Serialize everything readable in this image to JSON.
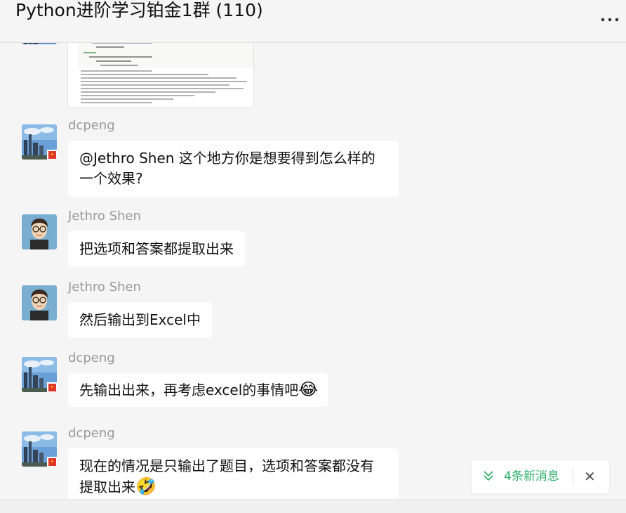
{
  "header": {
    "title": "Python进阶学习铂金1群 (110)",
    "more_icon": "more-icon"
  },
  "messages": [
    {
      "sender": "dcpeng",
      "text": "@Jethro Shen 这个地方你是想要得到怎么样的一个效果?",
      "avatar": "cityscape-avatar"
    },
    {
      "sender": "Jethro Shen",
      "text": "把选项和答案都提取出来",
      "avatar": "cartoon-avatar"
    },
    {
      "sender": "Jethro Shen",
      "text": "然后输出到Excel中",
      "avatar": "cartoon-avatar"
    },
    {
      "sender": "dcpeng",
      "text": "先输出出来，再考虑excel的事情吧",
      "emoji": "😂",
      "avatar": "cityscape-avatar"
    },
    {
      "sender": "dcpeng",
      "text": "现在的情况是只输出了题目，选项和答案都没有提取出来",
      "emoji": "🤣",
      "avatar": "cityscape-avatar"
    }
  ],
  "toast": {
    "text": "4条新消息",
    "icon": "double-chevron-down-icon",
    "close_icon": "close-icon",
    "close_label": "✕",
    "color": "#2aae67"
  }
}
